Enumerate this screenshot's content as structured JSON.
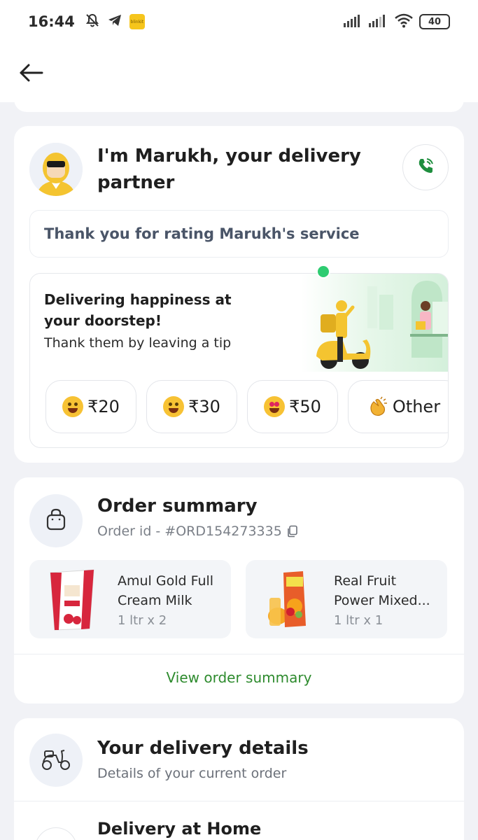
{
  "status_bar": {
    "time": "16:44",
    "battery": "40",
    "app_badge": "blinkit"
  },
  "partner": {
    "title": "I'm Marukh, your delivery partner",
    "rating_text": "Thank you for rating Marukh's service"
  },
  "tip": {
    "heading": "Delivering happiness at your doorstep!",
    "subtext": "Thank them by leaving a tip",
    "options": [
      {
        "label": "₹20",
        "icon": "grinning-face-emoji"
      },
      {
        "label": "₹30",
        "icon": "star-struck-emoji"
      },
      {
        "label": "₹50",
        "icon": "heart-eyes-emoji"
      },
      {
        "label": "Other",
        "icon": "clapping-hands-emoji"
      }
    ]
  },
  "order": {
    "title": "Order summary",
    "order_id": "Order id - #ORD154273335",
    "items": [
      {
        "name": "Amul Gold Full Cream Milk",
        "qty": "1 ltr x 2"
      },
      {
        "name": "Real Fruit Power Mixed...",
        "qty": "1 ltr x 1"
      }
    ],
    "view_link": "View order summary"
  },
  "delivery": {
    "title": "Your delivery details",
    "subtitle": "Details of your current order",
    "home_label": "Delivery at Home"
  },
  "colors": {
    "accent_green": "#2e8b2e",
    "call_green": "#1e8e3e",
    "tip_yellow": "#f4c430"
  }
}
